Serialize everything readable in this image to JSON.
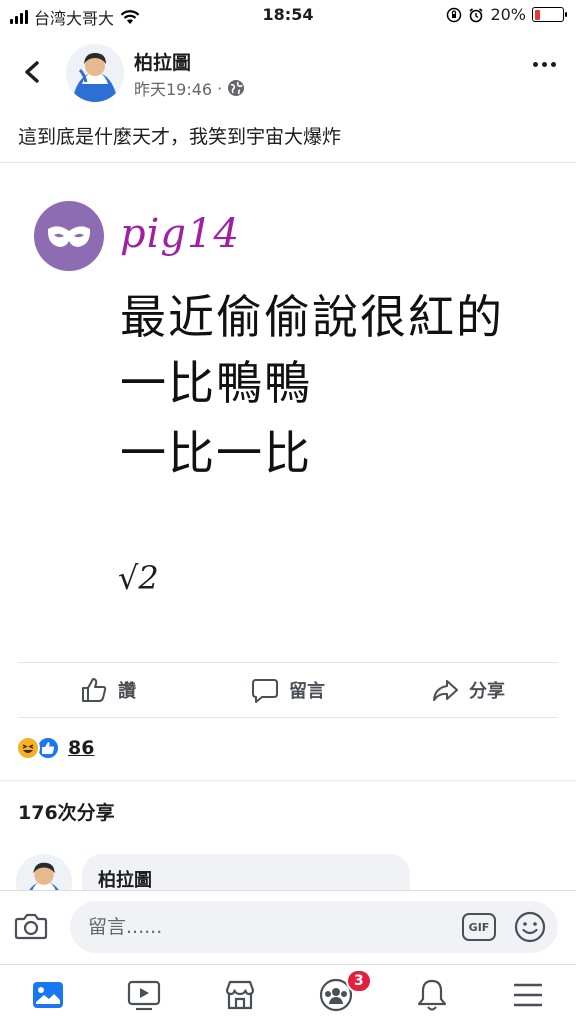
{
  "status_bar": {
    "carrier": "台湾大哥大",
    "time": "18:54",
    "battery": "20%",
    "battery_level": 0.2,
    "battery_color": "#e53935"
  },
  "header": {
    "back_icon": "chevron-left-icon",
    "author": "柏拉圖",
    "timestamp": "昨天19:46",
    "separator": "·",
    "audience_icon": "globe-icon",
    "more_icon": "more-horizontal-icon"
  },
  "post": {
    "caption": "這到底是什麼天才，我笑到宇宙大爆炸",
    "image": {
      "brand": "pig14",
      "brand_color": "#a11fa7",
      "logo_color": "#8d6cb3",
      "lines": [
        "最近偷偷說很紅的",
        "一比鴨鴨",
        "一比一比"
      ],
      "signature": "√2"
    }
  },
  "actions": {
    "like": "讚",
    "comment": "留言",
    "share": "分享"
  },
  "reactions": {
    "icons": [
      "haha-icon",
      "like-icon"
    ],
    "count": "86"
  },
  "shares": {
    "text": "176次分享"
  },
  "comment_preview": {
    "author": "柏拉圖"
  },
  "composer": {
    "placeholder": "留言......",
    "gif_label": "GIF"
  },
  "bottom_nav": {
    "items": [
      "news-feed-icon",
      "watch-icon",
      "marketplace-icon",
      "groups-icon",
      "notifications-icon",
      "menu-icon"
    ],
    "groups_badge": "3",
    "accent": "#1877f2"
  }
}
